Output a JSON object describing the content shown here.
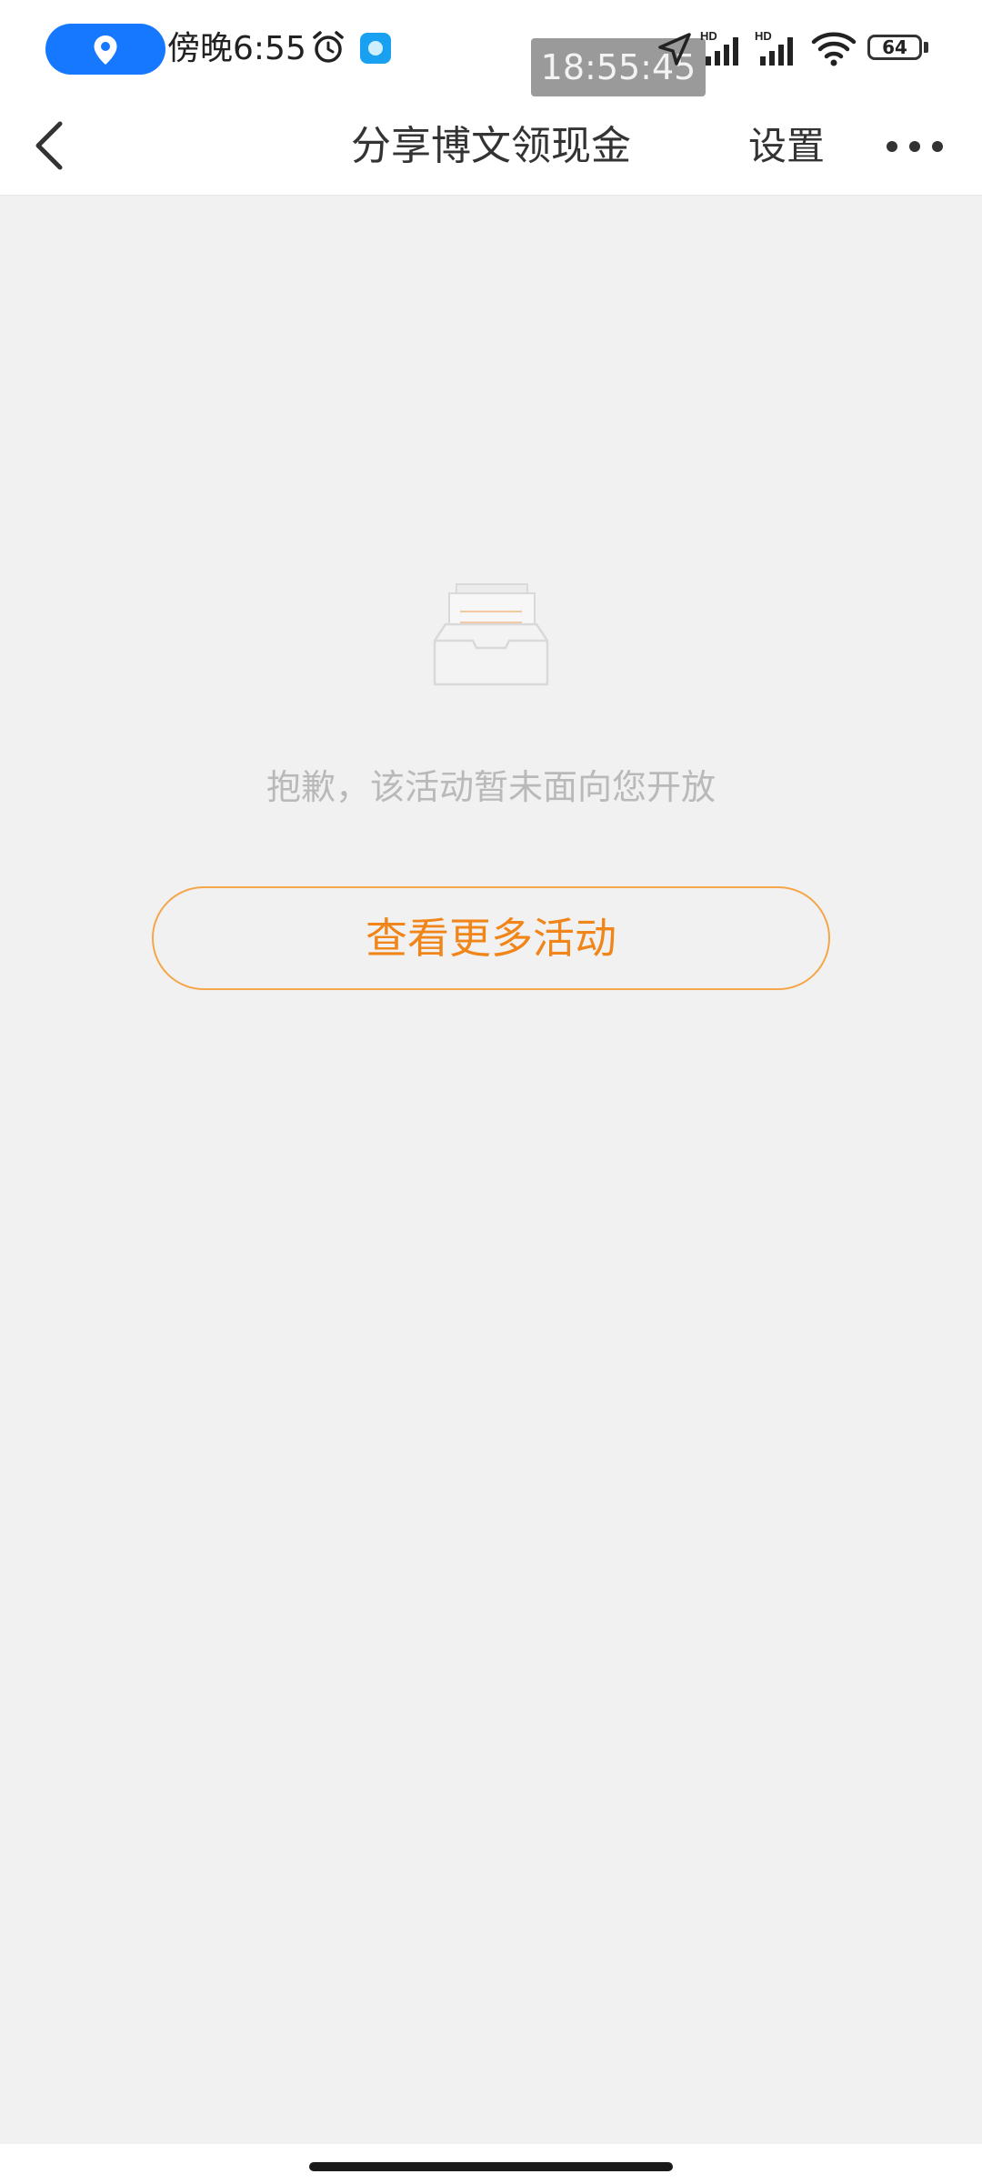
{
  "status_bar": {
    "time": "傍晚6:55",
    "clock_overlay": "18:55:45",
    "battery": "64",
    "icons": [
      "location-icon",
      "alarm-icon",
      "app-icon",
      "gps-icon",
      "signal-icon",
      "signal-icon",
      "wifi-icon",
      "battery-icon"
    ],
    "signal_label": "HD"
  },
  "header": {
    "title": "分享博文领现金",
    "settings_label": "设置",
    "back_icon": "chevron-left-icon",
    "more_icon": "more-horizontal-icon"
  },
  "empty_state": {
    "icon": "empty-inbox-icon",
    "message": "抱歉，该活动暂未面向您开放",
    "button_label": "查看更多活动"
  },
  "colors": {
    "accent": "#f08519",
    "button_border": "#f5a64a",
    "background": "#f1f1f1",
    "location_pill": "#1677ff"
  }
}
